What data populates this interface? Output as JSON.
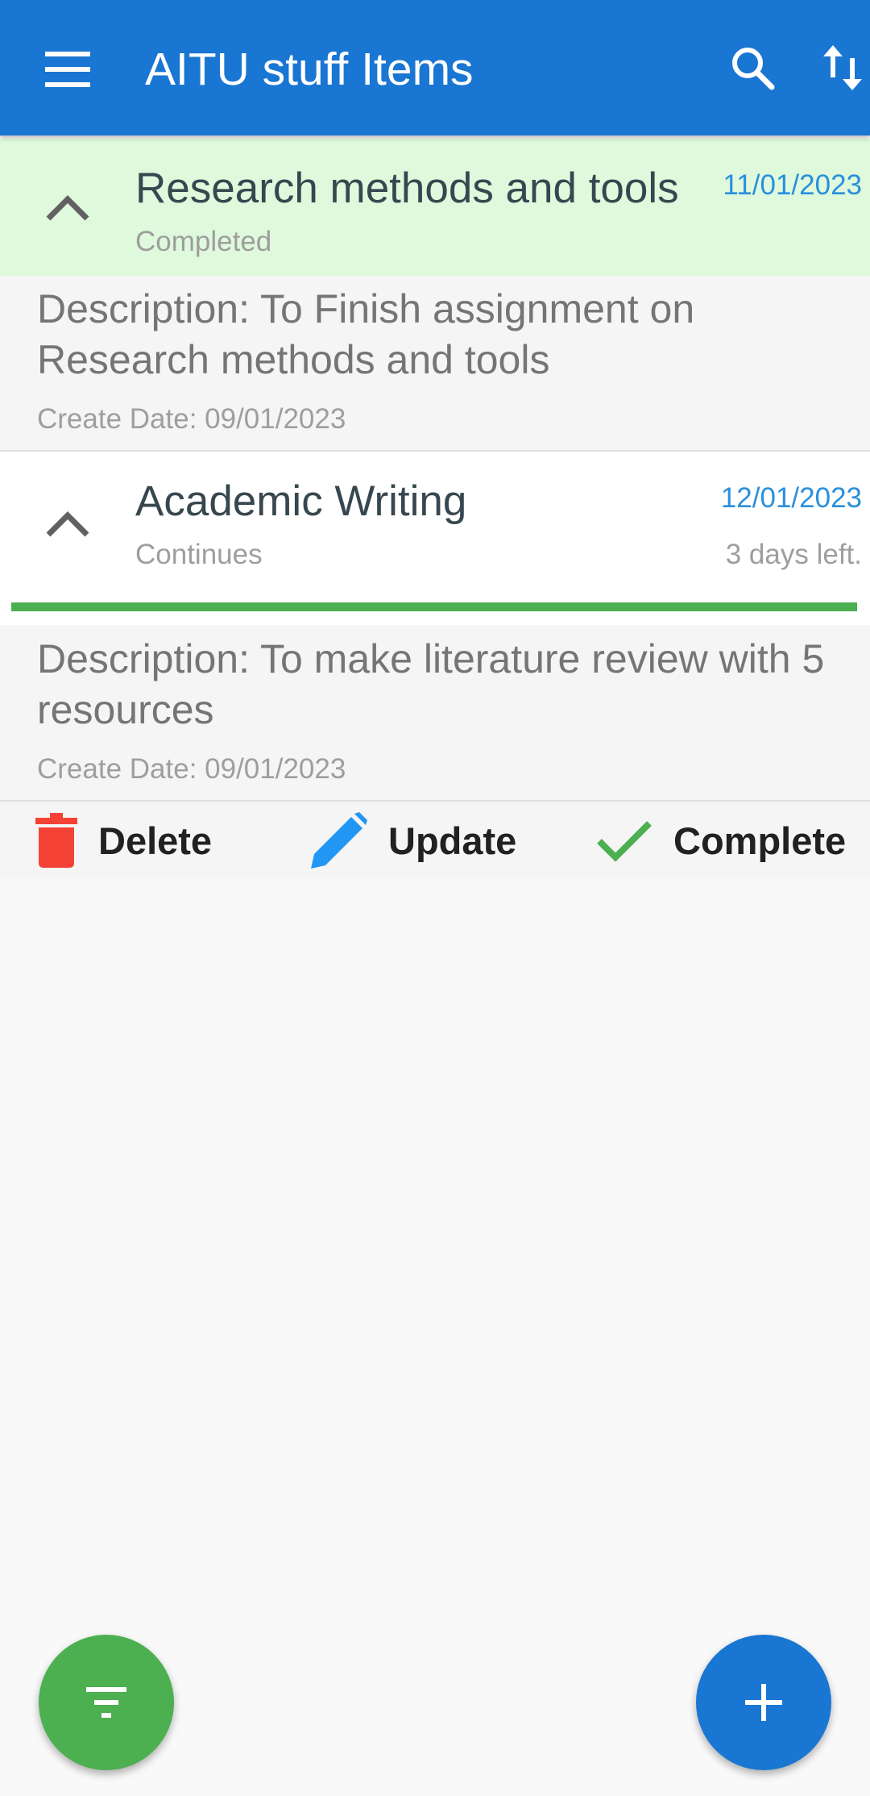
{
  "app_bar": {
    "title": "AITU stuff Items",
    "icons": [
      "menu-icon",
      "search-icon",
      "sort-icon"
    ],
    "color": "#1976d2"
  },
  "tasks": [
    {
      "title": "Research methods and tools",
      "status": "Completed",
      "due_date": "11/01/2023",
      "description": "Description: To Finish assignment on Research methods and tools",
      "create_date": "Create Date: 09/01/2023",
      "expanded": true,
      "background": "#dff9dc"
    },
    {
      "title": "Academic Writing",
      "status": "Continues",
      "due_date": "12/01/2023",
      "time_left": "3 days left.",
      "progress": 1.0,
      "description": "Description: To make literature review with 5 resources",
      "create_date": "Create Date: 09/01/2023",
      "expanded": true
    }
  ],
  "actions": {
    "delete_label": "Delete",
    "update_label": "Update",
    "complete_label": "Complete",
    "colors": {
      "delete": "#f44336",
      "update": "#2196f3",
      "complete": "#4caf50"
    }
  },
  "fabs": {
    "filter_icon": "filter-icon",
    "add_icon": "plus-icon",
    "filter_color": "#4caf50",
    "add_color": "#1976d2"
  }
}
